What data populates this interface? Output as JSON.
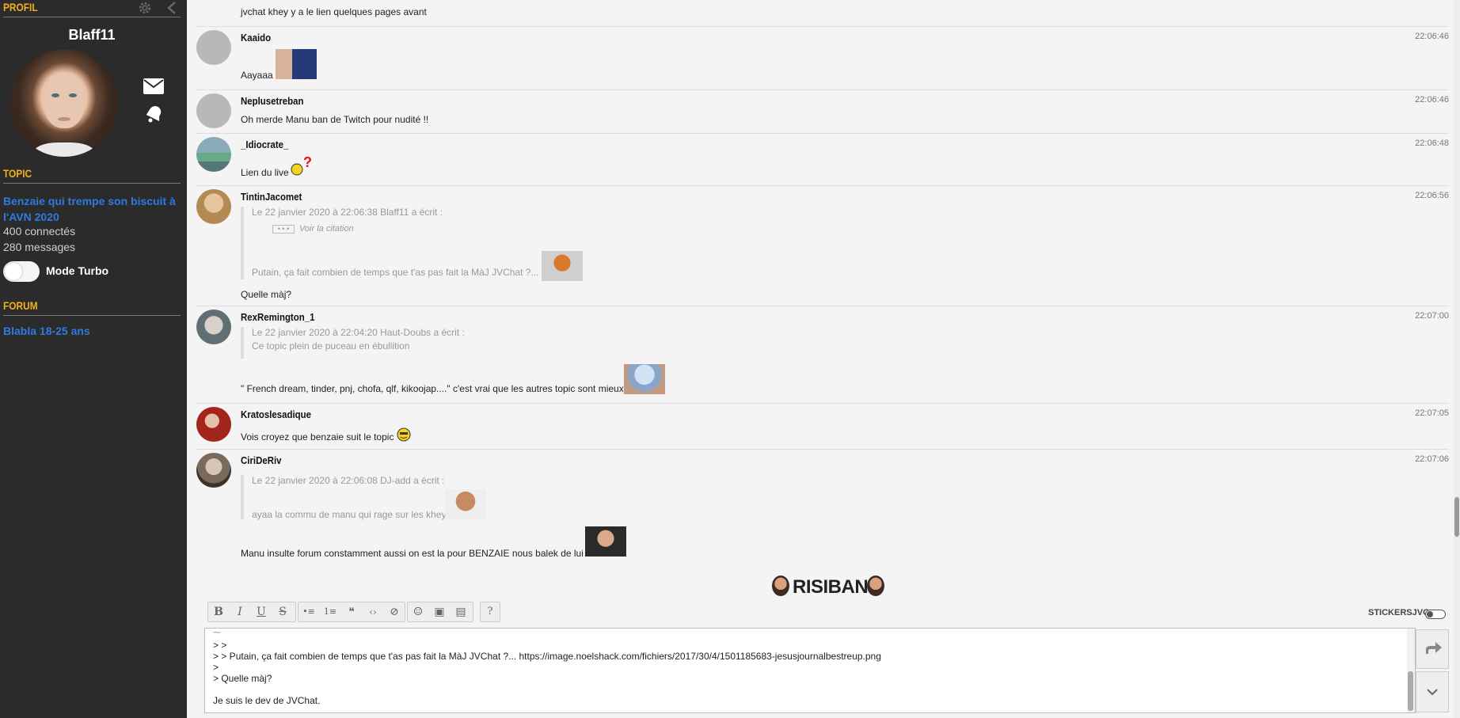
{
  "sidebar": {
    "profile_heading": "PROFIL",
    "username": "Blaff11",
    "topic_heading": "TOPIC",
    "topic_title": "Benzaie qui trempe son biscuit à l'AVN 2020",
    "connected": "400 connectés",
    "messages": "280 messages",
    "turbo_label": "Mode Turbo",
    "forum_heading": "FORUM",
    "forum_name": "Blabla 18-25 ans"
  },
  "messages": [
    {
      "author": "",
      "time": "",
      "text": "jvchat khey y a le lien quelques pages avant"
    },
    {
      "author": "Kaaido",
      "time": "22:06:46",
      "text": "Aayaaa"
    },
    {
      "author": "Neplusetreban",
      "time": "22:06:46",
      "text": "Oh merde Manu ban de Twitch pour nudité !!"
    },
    {
      "author": "_Idiocrate_",
      "time": "22:06:48",
      "text": "Lien du live"
    },
    {
      "author": "TintinJacomet",
      "time": "22:06:56",
      "quote_header": "Le 22 janvier 2020 à 22:06:38 Blaff11 a écrit :",
      "quote_more": "Voir la citation",
      "quote_body": "Putain, ça fait combien de temps que t'as pas fait la MàJ JVChat ?...",
      "text": "Quelle màj?"
    },
    {
      "author": "RexRemington_1",
      "time": "22:07:00",
      "quote_header": "Le 22 janvier 2020 à 22:04:20 Haut-Doubs a écrit :",
      "quote_body": "Ce topic plein de puceau en ébullition",
      "text": "\" French dream, tinder, pnj, chofa, qlf, kikoojap....\" c'est vrai que les autres topic sont mieux"
    },
    {
      "author": "Kratoslesadique",
      "time": "22:07:05",
      "text": "Vois croyez que benzaie suit le topic"
    },
    {
      "author": "CiriDeRiv",
      "time": "22:07:06",
      "quote_header": "Le 22 janvier 2020 à 22:06:08 DJ-add a écrit :",
      "quote_body": "ayaa la commu de manu qui rage sur les khey",
      "text": "Manu insulte forum constamment aussi on est la pour BENZAIE nous balek de lui"
    }
  ],
  "composer": {
    "risibank_label": "RISIBANK",
    "stickers_label": "STICKERSJVC",
    "toolbar": [
      "B",
      "I",
      "U",
      "S",
      "•≡",
      "1≡",
      "❝",
      "‹›",
      "⊘",
      "☺",
      "▣",
      "▤",
      "?"
    ],
    "lines": [
      "> >",
      "> > Putain, ça fait combien de temps que t'as pas fait la MàJ JVChat ?...  https://image.noelshack.com/fichiers/2017/30/4/1501185683-jesusjournalbestreup.png",
      ">",
      "> Quelle màj?",
      "Je suis le dev de JVChat."
    ]
  },
  "colors": {
    "sidebar_bg": "#2b2b2b",
    "section_heading": "#f2b01e",
    "link_blue": "#2e7be0"
  }
}
